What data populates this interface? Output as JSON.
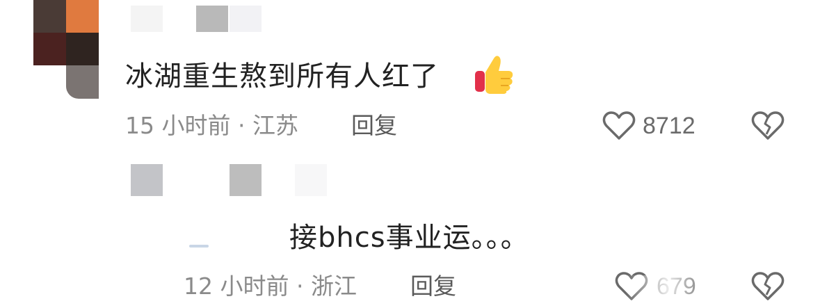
{
  "comments": [
    {
      "text": "冰湖重生熬到所有人红了",
      "emoji": "thumbs-up",
      "time": "15 小时前",
      "separator": "·",
      "location": "江苏",
      "reply_label": "回复",
      "like_count": "8712",
      "icons": [
        "heart-outline-icon",
        "broken-heart-icon"
      ]
    },
    {
      "text": "接bhcs事业运。。。",
      "time": "12 小时前",
      "separator": "·",
      "location": "浙江",
      "reply_label": "回复",
      "like_count": "679",
      "icons": [
        "heart-outline-icon",
        "broken-heart-icon"
      ]
    }
  ],
  "colors": {
    "avatar_orange": "#e07a3f",
    "avatar_dark": "#3b2a22",
    "avatar_red": "#5a2620",
    "avatar_gray": "#7b7472",
    "meta_gray": "#8a8a8a",
    "icon_gray": "#6a6a6a"
  }
}
